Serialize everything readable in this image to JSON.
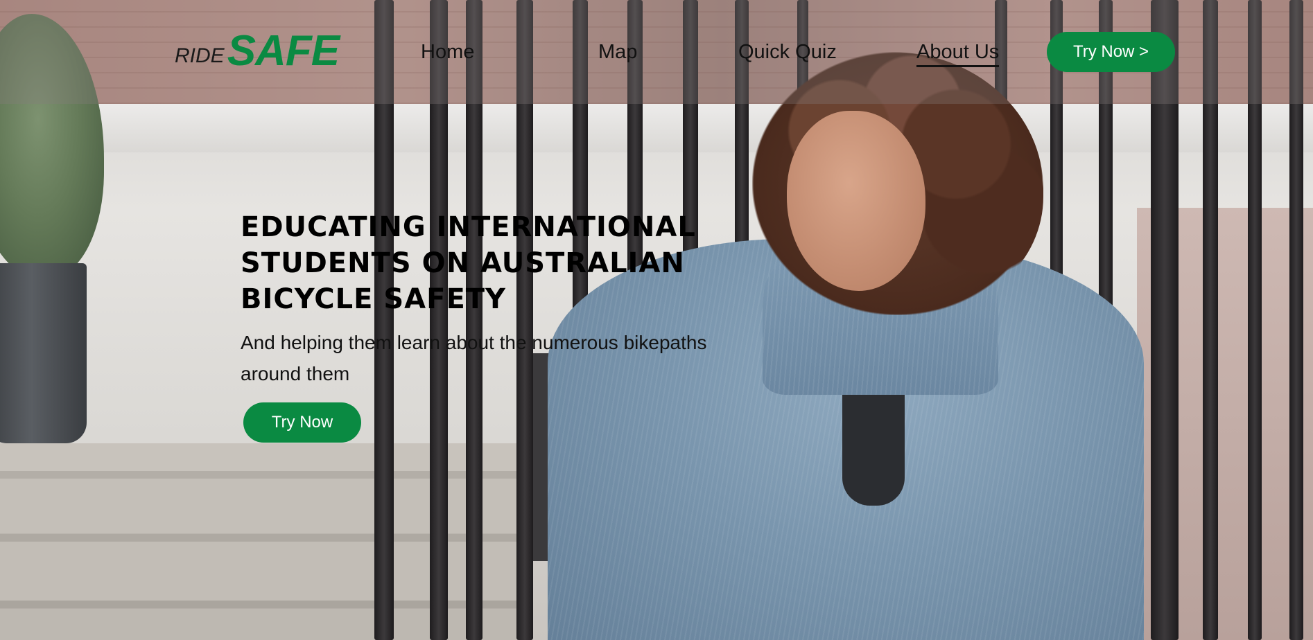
{
  "logo": {
    "prefix": "RIDE",
    "main": "SAFE"
  },
  "nav": {
    "items": [
      {
        "label": "Home",
        "active": false
      },
      {
        "label": "Map",
        "active": false
      },
      {
        "label": "Quick Quiz",
        "active": false
      },
      {
        "label": "About Us",
        "active": true
      }
    ],
    "cta_label": "Try Now >"
  },
  "hero": {
    "title": "EDUCATING INTERNATIONAL STUDENTS ON AUSTRALIAN BICYCLE SAFETY",
    "subtitle": "And helping them learn about the numerous bikepaths around them",
    "cta_label": "Try Now",
    "image": "woman-in-blue-corduroy-jacket-on-bicycle-photo"
  },
  "colors": {
    "brand_green": "#0a8a42",
    "text": "#111111",
    "button_text": "#ffffff"
  }
}
